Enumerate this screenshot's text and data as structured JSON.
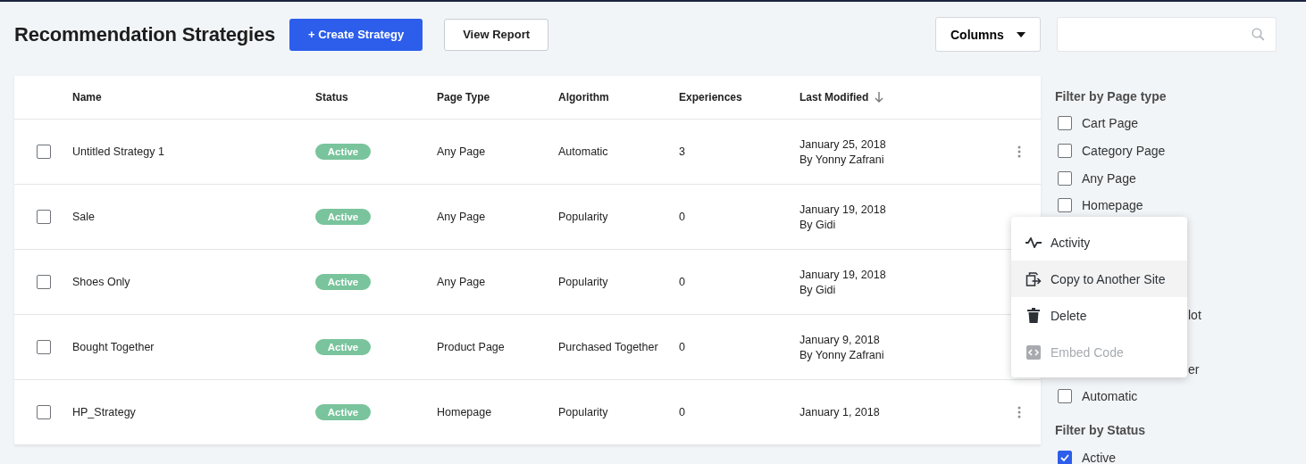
{
  "title": "Recommendation Strategies",
  "buttons": {
    "create": "+ Create Strategy",
    "report": "View Report",
    "columns": "Columns"
  },
  "table": {
    "columns": [
      {
        "label": "Name",
        "sorted": false
      },
      {
        "label": "Status",
        "sorted": false
      },
      {
        "label": "Page Type",
        "sorted": false
      },
      {
        "label": "Algorithm",
        "sorted": false
      },
      {
        "label": "Experiences",
        "sorted": false
      },
      {
        "label": "Last Modified",
        "sorted": true
      }
    ],
    "rows": [
      {
        "checked": false,
        "name": "Untitled Strategy 1",
        "status": "Active",
        "page_type": "Any Page",
        "algorithm": "Automatic",
        "experiences": "3",
        "date": "January 25, 2018",
        "by": "By Yonny Zafrani",
        "menu_open": false
      },
      {
        "checked": false,
        "name": "Sale",
        "status": "Active",
        "page_type": "Any Page",
        "algorithm": "Popularity",
        "experiences": "0",
        "date": "January 19, 2018",
        "by": "By Gidi",
        "menu_open": true
      },
      {
        "checked": false,
        "name": "Shoes Only",
        "status": "Active",
        "page_type": "Any Page",
        "algorithm": "Popularity",
        "experiences": "0",
        "date": "January 19, 2018",
        "by": "By Gidi",
        "menu_open": false
      },
      {
        "checked": false,
        "name": "Bought Together",
        "status": "Active",
        "page_type": "Product Page",
        "algorithm": "Purchased Together",
        "experiences": "0",
        "date": "January 9, 2018",
        "by": "By Yonny Zafrani",
        "menu_open": false
      },
      {
        "checked": false,
        "name": "HP_Strategy",
        "status": "Active",
        "page_type": "Homepage",
        "algorithm": "Popularity",
        "experiences": "0",
        "date": "January 1, 2018",
        "menu_open": false
      }
    ]
  },
  "context_menu": {
    "items": [
      {
        "label": "Activity",
        "kind": "activity",
        "hovered": false,
        "disabled": false
      },
      {
        "label": "Copy to Another Site",
        "kind": "copy",
        "hovered": true,
        "disabled": false
      },
      {
        "label": "Delete",
        "kind": "delete",
        "hovered": false,
        "disabled": false
      },
      {
        "label": "Embed Code",
        "kind": "embed",
        "hovered": false,
        "disabled": true
      }
    ]
  },
  "filters": {
    "page_type": {
      "heading": "Filter by Page type",
      "items": [
        {
          "label": "Cart Page",
          "checked": false
        },
        {
          "label": "Category Page",
          "checked": false
        },
        {
          "label": "Any Page",
          "checked": false
        },
        {
          "label": "Homepage",
          "checked": false
        }
      ]
    },
    "partial_items": [
      {
        "label": "lot"
      },
      {
        "label": "er"
      }
    ],
    "algorithm_items": [
      {
        "label": "Automatic",
        "checked": false
      }
    ],
    "status": {
      "heading": "Filter by Status",
      "items": [
        {
          "label": "Active",
          "checked": true
        }
      ]
    }
  }
}
